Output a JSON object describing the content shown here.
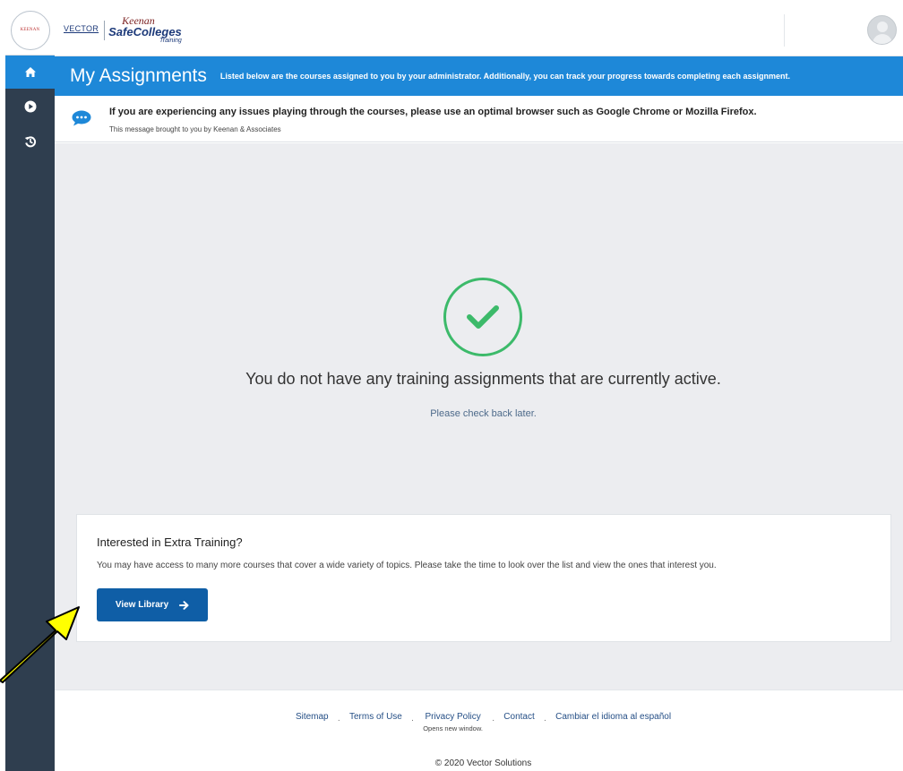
{
  "app": {
    "brand_vector": "VECTOR",
    "brand_keenan": "Keenan",
    "brand_name": "SafeColleges",
    "brand_sub": "Training",
    "logo_small_text": "KEENAN"
  },
  "sidebar": {
    "items": [
      {
        "icon": "home-icon",
        "active": true
      },
      {
        "icon": "play-circle-icon",
        "active": false
      },
      {
        "icon": "history-icon",
        "active": false
      }
    ]
  },
  "header": {
    "title": "My Assignments",
    "description": "Listed below are the courses assigned to you by your administrator. Additionally, you can track your progress towards completing each assignment."
  },
  "message": {
    "main": "If you are experiencing any issues playing through the courses, please use an optimal browser such as Google Chrome or Mozilla Firefox.",
    "sub": "This message brought to you by Keenan & Associates"
  },
  "main": {
    "empty_title": "You do not have any training assignments that are currently active.",
    "empty_sub": "Please check back later."
  },
  "extra": {
    "title": "Interested in Extra Training?",
    "text": "You may have access to many more courses that cover a wide variety of topics. Please take the time to look over the list and view the ones that interest you.",
    "button": "View Library"
  },
  "footer": {
    "links": {
      "sitemap": "Sitemap",
      "terms": "Terms of Use",
      "privacy": "Privacy Policy",
      "privacy_note": "Opens new window.",
      "contact": "Contact",
      "spanish": "Cambiar el idioma al español"
    },
    "copyright": "© 2020 Vector Solutions"
  },
  "colors": {
    "accent": "#1e88d8",
    "sidebar": "#2f3e4f",
    "button": "#0f5ea6",
    "success": "#3cba6a",
    "annotation_arrow": "#ffff00"
  }
}
